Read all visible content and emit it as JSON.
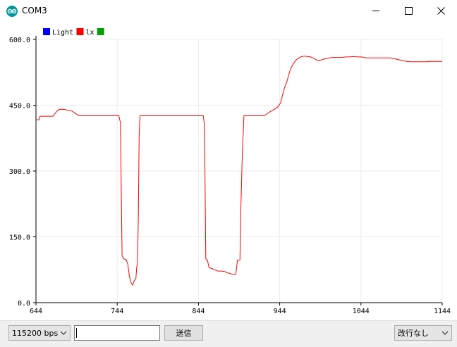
{
  "window": {
    "title": "COM3"
  },
  "legend": [
    {
      "label": "Light",
      "color": "#0000ff"
    },
    {
      "label": "lx",
      "color": "#ff0000"
    },
    {
      "label": "",
      "color": "#00a000"
    }
  ],
  "bottom": {
    "baud_label": "115200 bps",
    "input_value": "",
    "send_label": "送信",
    "line_ending_label": "改行なし"
  },
  "chart_data": {
    "type": "line",
    "xlim": [
      644,
      1144
    ],
    "ylim": [
      0,
      600
    ],
    "x_ticks": [
      "644",
      "744",
      "844",
      "944",
      "1044",
      "1144"
    ],
    "x_tick_values": [
      644,
      744,
      844,
      944,
      1044,
      1144
    ],
    "y_ticks": [
      "0.0",
      "150.0",
      "300.0",
      "450.0",
      "600.0"
    ],
    "y_tick_values": [
      0,
      150,
      300,
      450,
      600
    ],
    "grid": true,
    "legend_position": "top-left",
    "series": [
      {
        "name": "lx",
        "color": "#ff0000",
        "points": [
          [
            644,
            417
          ],
          [
            648,
            417
          ],
          [
            649,
            425
          ],
          [
            665,
            425
          ],
          [
            669,
            435
          ],
          [
            672,
            440
          ],
          [
            676,
            441
          ],
          [
            680,
            440
          ],
          [
            684,
            438
          ],
          [
            688,
            437
          ],
          [
            692,
            432
          ],
          [
            697,
            426
          ],
          [
            739,
            426
          ],
          [
            740,
            428
          ],
          [
            742,
            426
          ],
          [
            746,
            426
          ],
          [
            748,
            410
          ],
          [
            749,
            250
          ],
          [
            750,
            107
          ],
          [
            752,
            100
          ],
          [
            755,
            98
          ],
          [
            757,
            88
          ],
          [
            759,
            60
          ],
          [
            761,
            45
          ],
          [
            763,
            40
          ],
          [
            765,
            50
          ],
          [
            767,
            55
          ],
          [
            768,
            80
          ],
          [
            769,
            90
          ],
          [
            770,
            200
          ],
          [
            771,
            380
          ],
          [
            772,
            426
          ],
          [
            850,
            426
          ],
          [
            851,
            410
          ],
          [
            852,
            300
          ],
          [
            853,
            100
          ],
          [
            855,
            97
          ],
          [
            857,
            80
          ],
          [
            860,
            78
          ],
          [
            864,
            75
          ],
          [
            868,
            72
          ],
          [
            872,
            72
          ],
          [
            876,
            71
          ],
          [
            880,
            68
          ],
          [
            885,
            65
          ],
          [
            888,
            65
          ],
          [
            890,
            65
          ],
          [
            891,
            80
          ],
          [
            892,
            97
          ],
          [
            895,
            97
          ],
          [
            896,
            200
          ],
          [
            898,
            340
          ],
          [
            900,
            426
          ],
          [
            925,
            426
          ],
          [
            928,
            430
          ],
          [
            931,
            434
          ],
          [
            934,
            437
          ],
          [
            937,
            440
          ],
          [
            941,
            445
          ],
          [
            945,
            455
          ],
          [
            947,
            470
          ],
          [
            950,
            490
          ],
          [
            953,
            505
          ],
          [
            956,
            525
          ],
          [
            958,
            535
          ],
          [
            961,
            545
          ],
          [
            964,
            553
          ],
          [
            967,
            557
          ],
          [
            970,
            560
          ],
          [
            974,
            562
          ],
          [
            978,
            561
          ],
          [
            982,
            560
          ],
          [
            986,
            557
          ],
          [
            990,
            552
          ],
          [
            995,
            553
          ],
          [
            1000,
            556
          ],
          [
            1005,
            558
          ],
          [
            1010,
            559
          ],
          [
            1015,
            559
          ],
          [
            1020,
            559
          ],
          [
            1025,
            560
          ],
          [
            1030,
            560
          ],
          [
            1035,
            561
          ],
          [
            1040,
            560
          ],
          [
            1045,
            560
          ],
          [
            1050,
            558
          ],
          [
            1055,
            558
          ],
          [
            1060,
            558
          ],
          [
            1065,
            558
          ],
          [
            1070,
            558
          ],
          [
            1075,
            558
          ],
          [
            1080,
            558
          ],
          [
            1085,
            556
          ],
          [
            1090,
            554
          ],
          [
            1095,
            552
          ],
          [
            1100,
            550
          ],
          [
            1105,
            549
          ],
          [
            1110,
            549
          ],
          [
            1115,
            549
          ],
          [
            1120,
            549
          ],
          [
            1125,
            549
          ],
          [
            1130,
            550
          ],
          [
            1135,
            550
          ],
          [
            1140,
            550
          ],
          [
            1144,
            550
          ]
        ]
      }
    ]
  }
}
